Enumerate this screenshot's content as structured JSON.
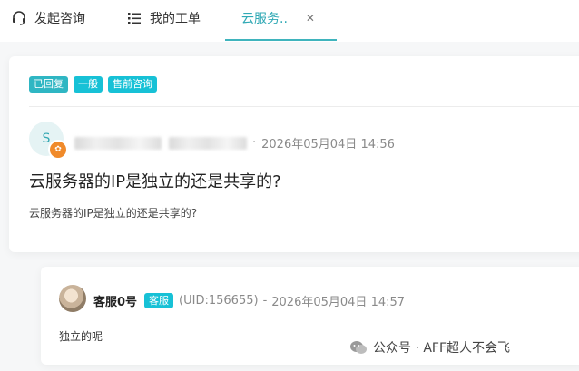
{
  "tabs": [
    {
      "label": "发起咨询",
      "icon": "headset-icon"
    },
    {
      "label": "我的工单",
      "icon": "list-icon"
    },
    {
      "label": "云服务..",
      "icon": "",
      "active": true
    }
  ],
  "ticket": {
    "tags": [
      "已回复",
      "一般",
      "售前咨询"
    ],
    "user_initial": "S",
    "meta_sep": "·",
    "timestamp": "2026年05月04日 14:56",
    "title": "云服务器的IP是独立的还是共享的?",
    "body": "云服务器的IP是独立的还是共享的?"
  },
  "reply": {
    "agent_name": "客服0号",
    "agent_badge": "客服",
    "uid_text": "(UID:156655)",
    "sep": "-",
    "timestamp": "2026年05月04日 14:57",
    "body": "独立的呢"
  },
  "watermark": {
    "text": "公众号 · AFF超人不会飞"
  },
  "colors": {
    "accent": "#30a9b5",
    "tag": "#17c1d6",
    "badge_orange": "#f08a2a"
  }
}
